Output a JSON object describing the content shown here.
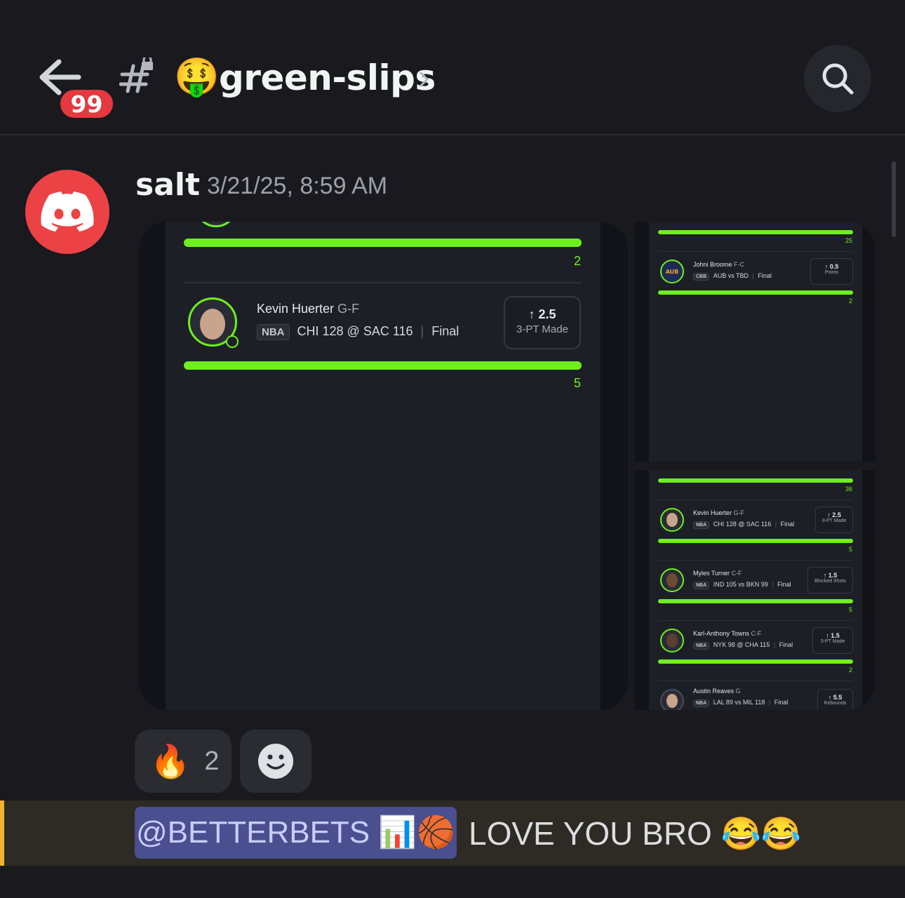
{
  "header": {
    "unread_count": "99",
    "channel_emoji": "🤑",
    "channel_name": "green-slips"
  },
  "message": {
    "author": "salt",
    "timestamp": "3/21/25, 8:59 AM"
  },
  "attachments": {
    "main": {
      "top_value": "2",
      "player": {
        "name": "Kevin Huerter",
        "position": "G-F",
        "league": "NBA",
        "game": "CHI 128 @ SAC 116",
        "status": "Final",
        "line": "2.5",
        "stat": "3-PT Made",
        "result": "5"
      }
    },
    "side1": {
      "top_value": "25",
      "player": {
        "name": "Johni Broome",
        "position": "F-C",
        "league": "CBB",
        "game": "AUB vs TBD",
        "status": "Final",
        "line": "0.5",
        "stat": "Points",
        "result": "2"
      }
    },
    "side2": {
      "top_value": "36",
      "players": [
        {
          "name": "Kevin Huerter",
          "position": "G-F",
          "league": "NBA",
          "game": "CHI 128 @ SAC 116",
          "status": "Final",
          "line": "2.5",
          "stat": "3-PT Made",
          "result": "5"
        },
        {
          "name": "Myles Turner",
          "position": "C-F",
          "league": "NBA",
          "game": "IND 105 vs BKN 99",
          "status": "Final",
          "line": "1.5",
          "stat": "Blocked Shots",
          "result": "5"
        },
        {
          "name": "Karl-Anthony Towns",
          "position": "C-F",
          "league": "NBA",
          "game": "NYK 98 @ CHA 115",
          "status": "Final",
          "line": "1.5",
          "stat": "3-PT Made",
          "result": "2"
        },
        {
          "name": "Austin Reaves",
          "position": "G",
          "league": "NBA",
          "game": "LAL 89 vs MIL 118",
          "status": "Final",
          "line": "5.5",
          "stat": "Rebounds",
          "result": ""
        }
      ]
    }
  },
  "reactions": [
    {
      "emoji": "🔥",
      "count": "2"
    }
  ],
  "next_message": {
    "mention": "@BETTERBETS 📊🏀",
    "text": "LOVE YOU BRO 😂😂"
  },
  "colors": {
    "accent_green": "#6fef1e",
    "badge_red": "#e5383f",
    "mention_bg": "#4a4f8f",
    "mention_stripe": "#f0b232"
  }
}
